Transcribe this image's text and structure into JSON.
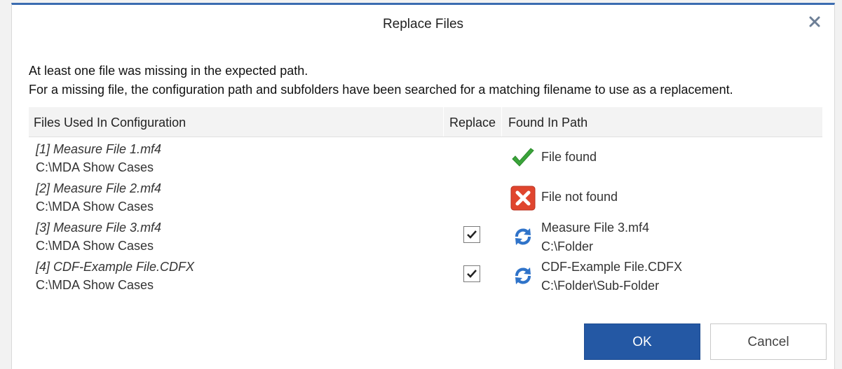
{
  "dialog": {
    "title": "Replace Files",
    "message_line1": "At least one file was missing in the expected path.",
    "message_line2": "For a missing file, the configuration path and subfolders have been searched for a matching filename to use as a replacement."
  },
  "table": {
    "columns": [
      "Files Used In Configuration",
      "Replace",
      "Found In Path"
    ],
    "rows": [
      {
        "name": "[1] Measure File 1.mf4",
        "path": "C:\\MDA Show Cases",
        "replace_checked": null,
        "status_icon": "check-icon",
        "found_line1": "File found",
        "found_line2": ""
      },
      {
        "name": "[2] Measure File 2.mf4",
        "path": "C:\\MDA Show Cases",
        "replace_checked": null,
        "status_icon": "error-icon",
        "found_line1": "File not found",
        "found_line2": ""
      },
      {
        "name": "[3] Measure File 3.mf4",
        "path": "C:\\MDA Show Cases",
        "replace_checked": true,
        "status_icon": "replace-icon",
        "found_line1": "Measure File 3.mf4",
        "found_line2": "C:\\Folder"
      },
      {
        "name": "[4] CDF-Example File.CDFX",
        "path": "C:\\MDA Show Cases",
        "replace_checked": true,
        "status_icon": "replace-icon",
        "found_line1": "CDF-Example File.CDFX",
        "found_line2": "C:\\Folder\\Sub-Folder"
      }
    ]
  },
  "buttons": {
    "ok": "OK",
    "cancel": "Cancel"
  },
  "colors": {
    "accent": "#2458a4",
    "success": "#3aa43a",
    "error": "#e0452e",
    "replace": "#2f73c9"
  }
}
